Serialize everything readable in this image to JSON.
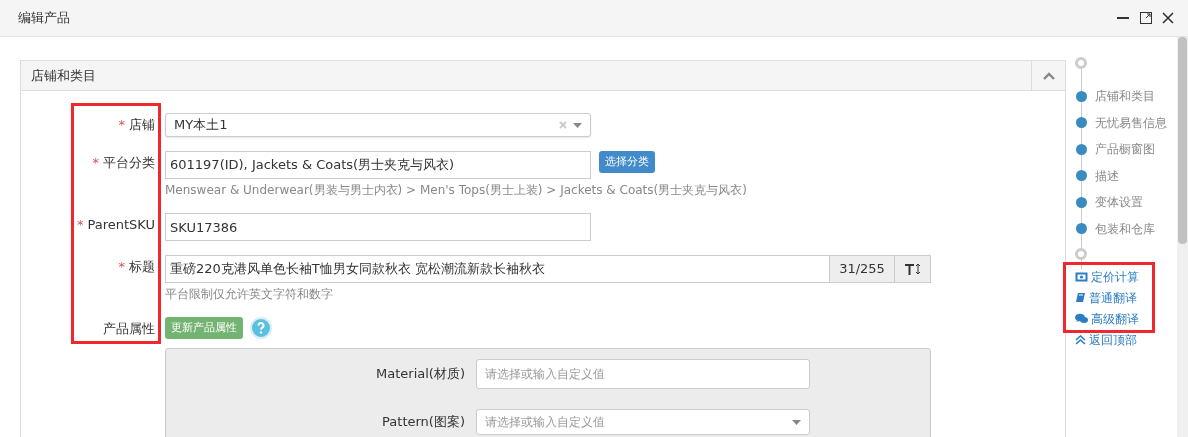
{
  "window": {
    "title": "编辑产品"
  },
  "section": {
    "title": "店铺和类目",
    "expanded": true
  },
  "labels_highlighted": true,
  "fields": [
    {
      "kind": "select",
      "label": "店铺",
      "marker": "*",
      "value": "MY本土1",
      "clearable": true
    },
    {
      "kind": "input",
      "label": "平台分类",
      "marker": "*",
      "value": "601197(ID), Jackets & Coats(男士夹克与风衣)",
      "button": "选择分类",
      "help": "Menswear & Underwear(男装与男士内衣) > Men's Tops(男士上装) > Jackets & Coats(男士夹克与风衣)"
    },
    {
      "kind": "input",
      "label": "ParentSKU",
      "marker": "*",
      "value": "SKU17386"
    },
    {
      "kind": "counted",
      "label": "标题",
      "marker": "*",
      "value": "重磅220克港风单色长袖T恤男女同款秋衣 宽松潮流新款长袖秋衣",
      "counter": "31/255",
      "help": "平台限制仅允许英文字符和数字"
    },
    {
      "kind": "attributes",
      "label": "产品属性",
      "button": "更新产品属性"
    }
  ],
  "attributes": [
    {
      "kind": "input",
      "label": "Material(材质)",
      "placeholder": "请选择或输入自定义值"
    },
    {
      "kind": "select",
      "label": "Pattern(图案)",
      "placeholder": "请选择或输入自定义值"
    }
  ],
  "nav": {
    "items": [
      {
        "label": "店铺和类目"
      },
      {
        "label": "无忧易售信息"
      },
      {
        "label": "产品橱窗图"
      },
      {
        "label": "描述"
      },
      {
        "label": "变体设置"
      },
      {
        "label": "包装和仓库"
      }
    ]
  },
  "tools": {
    "highlighted": true,
    "items": [
      {
        "kind": "pricing",
        "label": "定价计算"
      },
      {
        "kind": "translate",
        "label": "普通翻译"
      },
      {
        "kind": "chat",
        "label": "高级翻译"
      }
    ]
  },
  "back_to_top": "返回顶部"
}
